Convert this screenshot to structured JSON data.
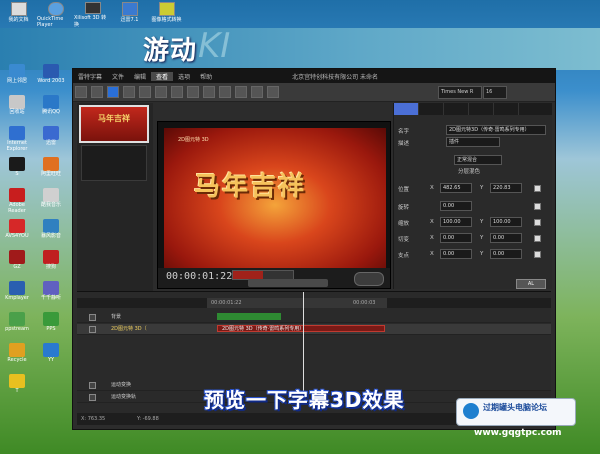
{
  "desktop": {
    "top_icons": [
      "我的文档",
      "QuickTime Player",
      "Xilisoft 3D 转换",
      "迅雷7.1",
      "图像格式转换"
    ],
    "left_icons": [
      "网上邻居",
      "回收站",
      "Internet Explorer",
      "S",
      "Adobe Reader",
      "AVS4YOU",
      "GZ",
      "Kmplayer",
      "ppstream",
      "Recycle",
      "T",
      "Word 2003",
      "腾讯QQ",
      "迅雷",
      "阿里旺旺",
      "酷我音乐",
      "暴风影音",
      "搜狗",
      "千千静听",
      "PPS",
      "YY"
    ],
    "bottom_icons": [
      "QQ",
      "会声会影",
      "Firefox"
    ]
  },
  "banner": {
    "title": "游动",
    "bg_letter": "KI"
  },
  "app": {
    "window_title": "北京宫特创科技有限公司 未命名",
    "menu": [
      "雷特字幕",
      "文件",
      "编辑",
      "查看",
      "选项",
      "帮助"
    ],
    "active_menu": "查看",
    "font_name": "Times New R",
    "font_size": "16",
    "preset_label": "马年吉祥",
    "preview": {
      "title_text": "马年吉祥",
      "small_text": "2D图元特 3D",
      "timecode": "00:00:01:22"
    },
    "props": {
      "name_label": "名字",
      "name_value": "2D图元特3D（传奇·雷鸣系列专用）",
      "desc_label": "描述",
      "desc_value": "插件",
      "mode_value": "正常混合",
      "section": "分层混色",
      "rows": [
        {
          "label": "位置",
          "x": "482.65",
          "y": "220.83"
        },
        {
          "label": "旋转",
          "x": "0.00",
          "y": ""
        },
        {
          "label": "缩放",
          "x": "100.00",
          "y": "100.00"
        },
        {
          "label": "切变",
          "x": "0.00",
          "y": "0.00"
        },
        {
          "label": "支点",
          "x": "0.00",
          "y": "0.00"
        }
      ],
      "x_label": "X",
      "y_label": "Y",
      "ok_label": "AL"
    },
    "timeline": {
      "ruler_start": "00:00:01:22",
      "ruler_end": "00:00:03",
      "tracks": [
        {
          "name": "背景",
          "clip": ""
        },
        {
          "name": "2D图元特 3D（",
          "clip": "2D图元特 3D（传奇·雷鸣系列专用）"
        },
        {
          "name": "运动变换",
          "clip": ""
        },
        {
          "name": "运动变换轨",
          "clip": ""
        }
      ],
      "status_x": "X: 763.35",
      "status_y": "Y: -69.88"
    }
  },
  "caption": "预览一下字幕3D效果",
  "watermark": {
    "line1": "过期罐头电脑论坛",
    "line2": "www.gqgtpc.com"
  }
}
